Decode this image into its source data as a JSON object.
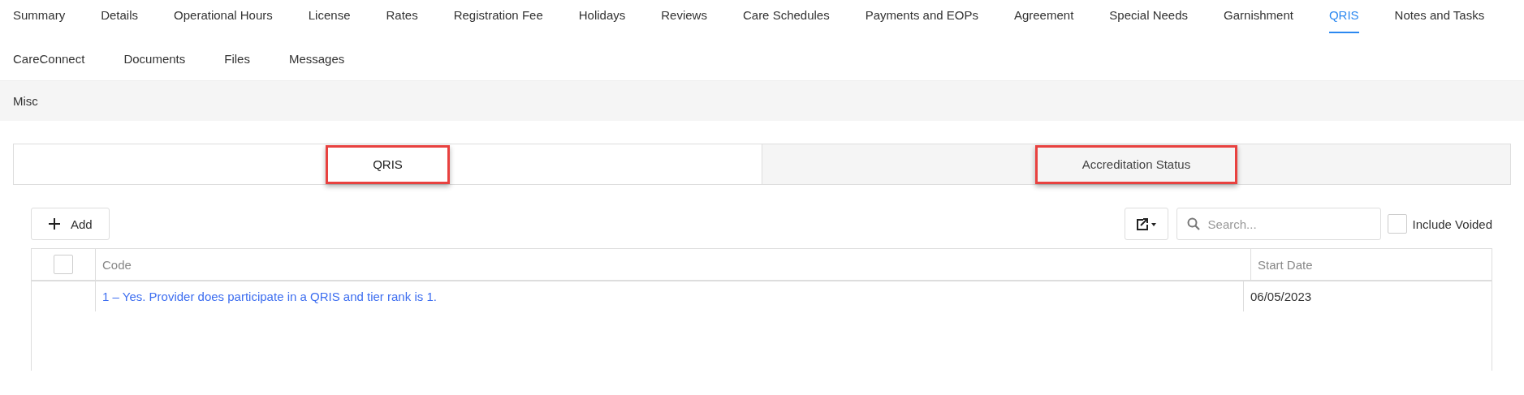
{
  "nav_tab_rows": [
    [
      {
        "label": "Summary",
        "selected": false
      },
      {
        "label": "Details",
        "selected": false
      },
      {
        "label": "Operational Hours",
        "selected": false
      },
      {
        "label": "License",
        "selected": false
      },
      {
        "label": "Rates",
        "selected": false
      },
      {
        "label": "Registration Fee",
        "selected": false
      },
      {
        "label": "Holidays",
        "selected": false
      },
      {
        "label": "Reviews",
        "selected": false
      },
      {
        "label": "Care Schedules",
        "selected": false
      },
      {
        "label": "Payments and EOPs",
        "selected": false
      },
      {
        "label": "Agreement",
        "selected": false
      },
      {
        "label": "Special Needs",
        "selected": false
      },
      {
        "label": "Garnishment",
        "selected": false
      },
      {
        "label": "QRIS",
        "selected": true
      },
      {
        "label": "Notes and Tasks",
        "selected": false
      }
    ],
    [
      {
        "label": "CareConnect",
        "selected": false
      },
      {
        "label": "Documents",
        "selected": false
      },
      {
        "label": "Files",
        "selected": false
      },
      {
        "label": "Messages",
        "selected": false
      }
    ]
  ],
  "section_bar": {
    "title": "Misc"
  },
  "sub_tabs": [
    {
      "label": "QRIS",
      "selected": true,
      "highlighted": true
    },
    {
      "label": "Accreditation Status",
      "selected": false,
      "highlighted": true
    }
  ],
  "toolbar": {
    "add_button": "Add",
    "search": {
      "placeholder": "Search..."
    },
    "include_voided": {
      "label": "Include Voided",
      "checked": false
    }
  },
  "table": {
    "select_all_checked": false,
    "columns": [
      "Code",
      "Start Date"
    ],
    "rows": [
      {
        "code": "1 – Yes. Provider does participate in a QRIS and tier rank is 1.",
        "start_date": "06/05/2023"
      }
    ]
  }
}
